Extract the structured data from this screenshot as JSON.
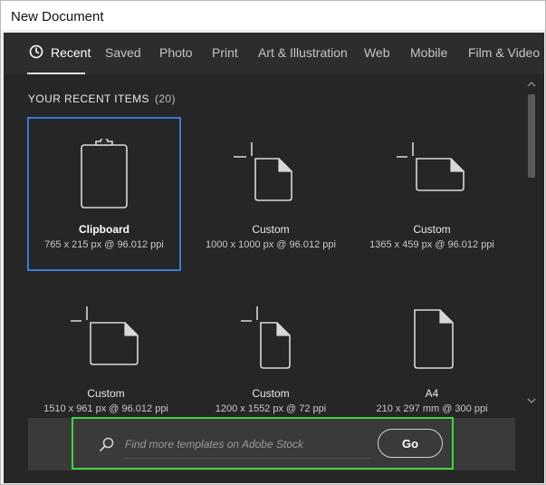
{
  "window": {
    "title": "New Document"
  },
  "tabs": [
    {
      "label": "Recent",
      "icon": "clock-icon",
      "active": true
    },
    {
      "label": "Saved"
    },
    {
      "label": "Photo"
    },
    {
      "label": "Print"
    },
    {
      "label": "Art & Illustration"
    },
    {
      "label": "Web"
    },
    {
      "label": "Mobile"
    },
    {
      "label": "Film & Video"
    }
  ],
  "recent": {
    "heading": "YOUR RECENT ITEMS",
    "count": "(20)",
    "items": [
      {
        "name": "Clipboard",
        "size": "765 x 215 px @ 96.012 ppi",
        "icon": "clipboard-icon",
        "selected": true
      },
      {
        "name": "Custom",
        "size": "1000 x 1000 px @ 96.012 ppi",
        "icon": "custom-document-icon"
      },
      {
        "name": "Custom",
        "size": "1365 x 459 px @ 96.012 ppi",
        "icon": "custom-document-icon"
      },
      {
        "name": "Custom",
        "size": "1510 x 961 px @ 96.012 ppi",
        "icon": "custom-document-icon"
      },
      {
        "name": "Custom",
        "size": "1200 x 1552 px @ 72 ppi",
        "icon": "custom-document-icon"
      },
      {
        "name": "A4",
        "size": "210 x 297 mm @ 300 ppi",
        "icon": "document-icon"
      }
    ]
  },
  "search": {
    "placeholder": "Find more templates on Adobe Stock",
    "go_label": "Go"
  },
  "colors": {
    "panel": "#2d2d2d",
    "content": "#262626",
    "selection": "#3a7bd5",
    "highlight": "#3dd63d"
  }
}
